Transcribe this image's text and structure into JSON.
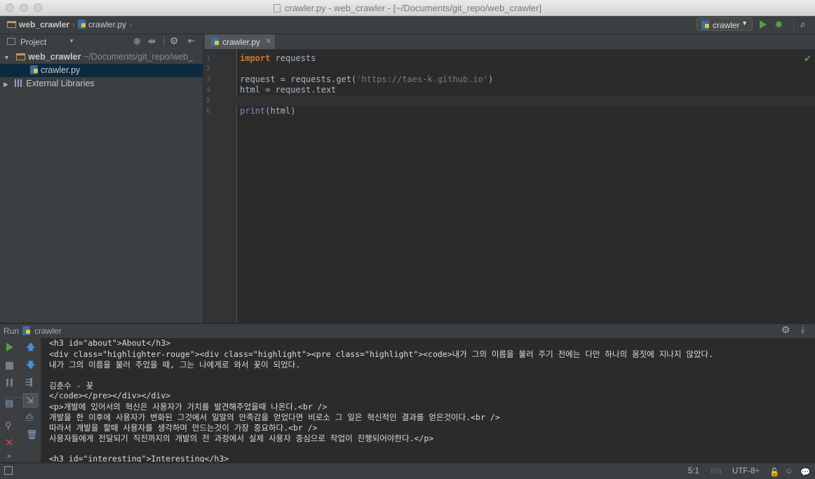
{
  "window": {
    "title": "crawler.py - web_crawler - [~/Documents/git_repo/web_crawler]"
  },
  "navbar": {
    "crumb_project": "web_crawler",
    "crumb_file": "crawler.py",
    "run_config": "crawler"
  },
  "project_panel": {
    "title": "Project",
    "tree": {
      "root_name": "web_crawler",
      "root_path": "~/Documents/git_repo/web_",
      "file": "crawler.py",
      "external": "External Libraries"
    }
  },
  "editor": {
    "tab_label": "crawler.py",
    "line_numbers": [
      "1",
      "2",
      "3",
      "4",
      "5",
      "6"
    ],
    "code": {
      "l1_kw": "import",
      "l1_rest": " requests",
      "l3_a": "request = requests.get(",
      "l3_str": "'https://taes-k.github.io'",
      "l3_b": ")",
      "l4": "html = request.text",
      "l6_fn": "print",
      "l6_rest": "(html)"
    }
  },
  "run_panel": {
    "label": "Run",
    "config": "crawler",
    "console_lines": [
      "<h3 id=\"about\">About</h3>",
      "<div class=\"highlighter-rouge\"><div class=\"highlight\"><pre class=\"highlight\"><code>내가 그의 이름을 불러 주기 전에는 다만 하나의 몸짓에 지나지 않았다.",
      "내가 그의 이름을 불러 주었을 때, 그는 나에게로 와서 꽃이 되었다.",
      "",
      "김춘수 - 꽃",
      "</code></pre></div></div>",
      "<p>개발에 있어서의 혁신은 사용자가 가치를 발견해주었을때 나온다.<br />",
      "개발을 한 이후에 사용자가 변화된 그것에서 일말의 만족감을 얻었다면 비로소 그 일은 혁신적인 결과를 얻은것이다.<br />",
      "따라서 개발을 할때 사용자를 생각하며 만드는것이 가장 중요하다.<br />",
      "사용자들에게 전달되기 직전까지의 개발의 전 과정에서 실제 사용자 중심으로 작업이 진행되어야한다.</p>",
      "",
      "<h3 id=\"interesting\">Interesting</h3>"
    ]
  },
  "statusbar": {
    "position": "5:1",
    "na": "n/a",
    "encoding": "UTF-8÷"
  },
  "colors": {
    "accent_green": "#4fa43c",
    "selection": "#0d293e",
    "keyword": "#cc7832",
    "string": "#6a8759"
  }
}
